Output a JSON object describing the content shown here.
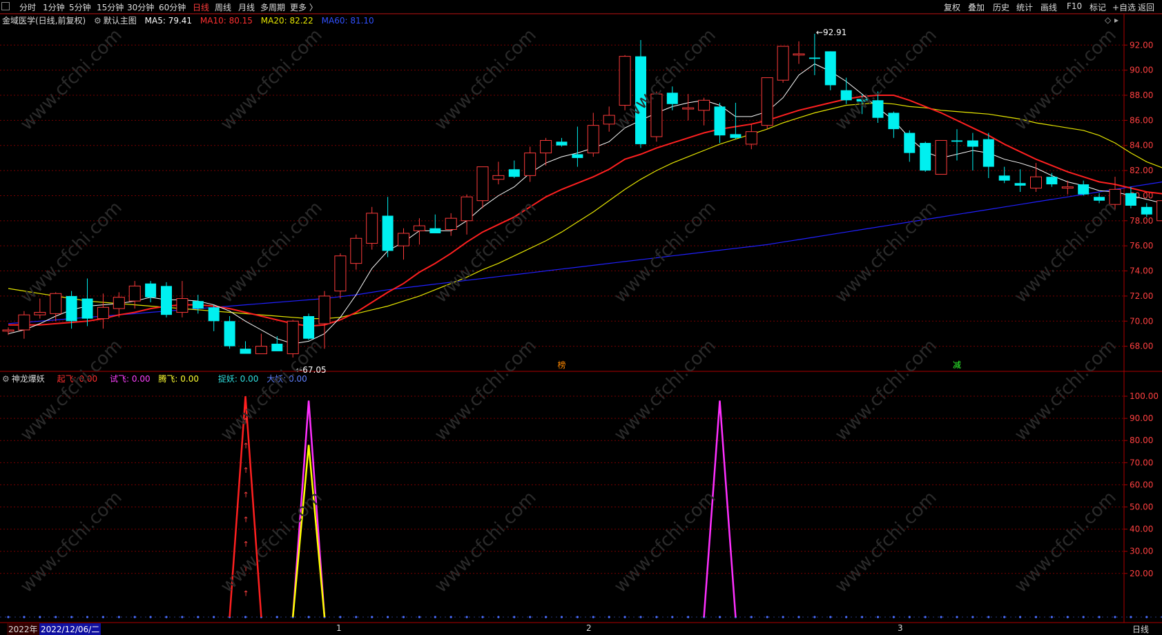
{
  "toolbar": {
    "tabs": [
      "分时",
      "1分钟",
      "5分钟",
      "15分钟",
      "30分钟",
      "60分钟",
      "日线",
      "周线",
      "月线",
      "多周期",
      "更多 〉"
    ],
    "active_tab": "日线",
    "right_buttons": [
      "复权",
      "叠加",
      "历史",
      "统计",
      "画线",
      "F10",
      "标记",
      "+自选",
      "返回"
    ]
  },
  "main_info": {
    "stock": "金域医学(日线,前复权)",
    "template": "默认主图",
    "ma5": "MA5: 79.41",
    "ma10": "MA10: 80.15",
    "ma20": "MA20: 82.22",
    "ma60": "MA60: 81.10"
  },
  "indicator_info": {
    "name": "神龙爆妖",
    "qifei": "起飞: 0.00",
    "shifei": "试飞: 0.00",
    "tengfei": "腾飞: 0.00",
    "zhuoyao": "捉妖: 0.00",
    "dayao": "大妖: 0.00"
  },
  "bottom": {
    "year": "2022年",
    "cursor_date": "2022/12/06/二",
    "month_marks": [
      "1",
      "2",
      "3"
    ],
    "period_button": "日线"
  },
  "colors": {
    "up": "#ff3b3b",
    "down": "#00f0f0",
    "ma5": "#ffffff",
    "ma10": "#ff2020",
    "ma20": "#e6e600",
    "ma60": "#2020ff",
    "qifei": "#ff2020",
    "shifei": "#ff30ff",
    "tengfei": "#ffff00",
    "zhuoyao": "#00e0e0",
    "dayao": "#4a6cff"
  },
  "chart_data": [
    {
      "type": "candlestick",
      "title": "金域医学(日线,前复权)",
      "ylim": [
        66.0,
        93.5
      ],
      "y_ticks": [
        68,
        70,
        72,
        74,
        76,
        78,
        80,
        82,
        84,
        86,
        88,
        90,
        92
      ],
      "y_tick_labels": [
        "68.00",
        "70.00",
        "72.00",
        "74.00",
        "76.00",
        "78.00",
        "80.00",
        "82.00",
        "84.00",
        "86.00",
        "88.00",
        "90.00",
        "92.00"
      ],
      "max_label": "92.91",
      "min_label": "67.05",
      "event_labels": [
        "榜",
        "减"
      ],
      "candles": [
        [
          69.2,
          69.5,
          68.9,
          69.3
        ],
        [
          69.3,
          70.8,
          68.6,
          70.5
        ],
        [
          70.5,
          71.8,
          70.2,
          70.7
        ],
        [
          70.6,
          72.3,
          70.0,
          72.2
        ],
        [
          72.0,
          72.4,
          69.4,
          70.0
        ],
        [
          71.8,
          73.4,
          69.6,
          70.2
        ],
        [
          70.2,
          72.2,
          69.4,
          71.1
        ],
        [
          71.0,
          72.3,
          70.3,
          71.9
        ],
        [
          71.6,
          73.2,
          71.0,
          72.8
        ],
        [
          73.0,
          73.2,
          71.5,
          71.9
        ],
        [
          72.8,
          73.1,
          70.3,
          70.5
        ],
        [
          70.7,
          73.2,
          70.3,
          71.8
        ],
        [
          71.6,
          72.1,
          70.6,
          71.0
        ],
        [
          71.1,
          71.3,
          69.2,
          70.0
        ],
        [
          70.0,
          70.4,
          67.8,
          68.0
        ],
        [
          67.8,
          68.4,
          67.5,
          67.4
        ],
        [
          67.4,
          69.0,
          67.4,
          68.0
        ],
        [
          68.2,
          68.8,
          67.7,
          67.6
        ],
        [
          67.4,
          70.1,
          67.1,
          70.0
        ],
        [
          70.4,
          70.6,
          68.5,
          68.6
        ],
        [
          69.8,
          72.4,
          67.8,
          72.0
        ],
        [
          72.4,
          75.4,
          71.8,
          75.2
        ],
        [
          74.6,
          76.9,
          74.1,
          76.6
        ],
        [
          76.2,
          79.1,
          75.7,
          78.6
        ],
        [
          78.4,
          79.9,
          75.1,
          75.6
        ],
        [
          76.0,
          77.4,
          74.9,
          77.0
        ],
        [
          77.2,
          78.2,
          76.1,
          77.6
        ],
        [
          77.4,
          78.5,
          77.0,
          77.0
        ],
        [
          77.3,
          78.6,
          76.8,
          78.2
        ],
        [
          78.0,
          80.1,
          76.9,
          79.9
        ],
        [
          79.6,
          81.8,
          79.0,
          82.3
        ],
        [
          81.3,
          82.7,
          80.9,
          81.6
        ],
        [
          82.1,
          82.8,
          81.4,
          81.5
        ],
        [
          81.6,
          83.9,
          81.1,
          83.4
        ],
        [
          83.4,
          84.6,
          82.4,
          84.4
        ],
        [
          84.3,
          84.6,
          83.9,
          84.0
        ],
        [
          83.3,
          85.5,
          82.3,
          83.0
        ],
        [
          83.4,
          86.6,
          83.1,
          85.6
        ],
        [
          85.7,
          87.1,
          85.1,
          86.4
        ],
        [
          87.2,
          91.2,
          86.8,
          91.1
        ],
        [
          91.1,
          92.4,
          83.8,
          84.1
        ],
        [
          84.7,
          88.3,
          84.3,
          88.1
        ],
        [
          88.2,
          88.7,
          86.8,
          87.3
        ],
        [
          86.9,
          88.1,
          86.0,
          87.0
        ],
        [
          86.8,
          87.8,
          85.6,
          87.6
        ],
        [
          87.1,
          87.4,
          84.2,
          84.8
        ],
        [
          84.9,
          87.4,
          84.5,
          84.6
        ],
        [
          84.1,
          85.7,
          83.7,
          85.1
        ],
        [
          85.6,
          89.4,
          85.3,
          89.4
        ],
        [
          89.2,
          90.8,
          89.0,
          91.9
        ],
        [
          91.2,
          92.3,
          90.5,
          91.3
        ],
        [
          91.0,
          92.9,
          89.6,
          90.9
        ],
        [
          91.5,
          91.5,
          88.4,
          88.8
        ],
        [
          88.4,
          89.4,
          87.3,
          87.6
        ],
        [
          87.7,
          88.1,
          86.5,
          87.5
        ],
        [
          87.6,
          88.3,
          85.8,
          86.2
        ],
        [
          86.6,
          86.7,
          84.6,
          85.3
        ],
        [
          85.0,
          85.2,
          82.7,
          83.4
        ],
        [
          84.2,
          84.3,
          81.9,
          82.0
        ],
        [
          81.7,
          84.4,
          81.8,
          84.4
        ],
        [
          84.4,
          85.3,
          82.8,
          84.3
        ],
        [
          84.4,
          85.0,
          82.0,
          83.9
        ],
        [
          84.5,
          85.0,
          81.4,
          82.3
        ],
        [
          81.6,
          82.3,
          81.0,
          81.2
        ],
        [
          81.0,
          82.1,
          80.3,
          80.8
        ],
        [
          80.6,
          82.6,
          80.3,
          81.5
        ],
        [
          81.5,
          81.8,
          80.7,
          80.9
        ],
        [
          80.6,
          81.2,
          80.1,
          80.7
        ],
        [
          80.9,
          81.2,
          80.0,
          80.1
        ],
        [
          79.9,
          80.2,
          79.4,
          79.6
        ],
        [
          79.3,
          81.5,
          78.9,
          80.5
        ],
        [
          80.2,
          80.7,
          79.0,
          79.2
        ],
        [
          79.1,
          79.4,
          78.3,
          78.5
        ],
        [
          78.0,
          80.3,
          77.9,
          79.6
        ]
      ],
      "ma5": [
        69.0,
        69.3,
        69.8,
        70.4,
        70.9,
        71.2,
        71.3,
        71.4,
        71.6,
        71.9,
        71.7,
        71.7,
        71.6,
        71.3,
        70.8,
        70.0,
        69.3,
        68.6,
        68.2,
        68.4,
        69.0,
        70.3,
        72.1,
        74.2,
        75.6,
        76.3,
        77.2,
        77.2,
        77.2,
        78.0,
        79.1,
        80.0,
        80.7,
        81.8,
        82.6,
        83.1,
        83.4,
        83.8,
        84.3,
        85.4,
        86.0,
        86.6,
        87.1,
        87.4,
        87.6,
        87.2,
        86.3,
        86.3,
        86.7,
        87.8,
        89.6,
        90.5,
        89.9,
        89.1,
        88.1,
        87.0,
        86.0,
        84.6,
        83.5,
        83.0,
        83.3,
        83.6,
        83.4,
        82.9,
        82.6,
        82.2,
        81.6,
        81.1,
        80.8,
        80.4,
        80.3,
        80.0,
        79.7,
        79.4
      ],
      "ma10": [
        69.7,
        69.7,
        69.7,
        69.8,
        69.9,
        70.0,
        70.2,
        70.5,
        70.7,
        71.0,
        71.2,
        71.3,
        71.3,
        71.2,
        71.0,
        70.7,
        70.4,
        70.1,
        69.8,
        69.6,
        69.7,
        70.1,
        70.7,
        71.5,
        72.3,
        73.0,
        73.9,
        74.6,
        75.4,
        76.3,
        77.1,
        77.7,
        78.3,
        79.1,
        79.9,
        80.5,
        81.0,
        81.5,
        82.1,
        82.9,
        83.3,
        83.8,
        84.2,
        84.6,
        85.0,
        85.3,
        85.5,
        85.7,
        86.0,
        86.4,
        86.8,
        87.1,
        87.4,
        87.7,
        87.9,
        88.0,
        88.0,
        87.6,
        87.1,
        86.6,
        86.0,
        85.4,
        84.8,
        84.1,
        83.5,
        82.9,
        82.4,
        81.9,
        81.5,
        81.1,
        80.9,
        80.6,
        80.3,
        80.15
      ],
      "ma20": [
        72.6,
        72.4,
        72.2,
        72.0,
        71.8,
        71.6,
        71.5,
        71.4,
        71.3,
        71.2,
        71.1,
        71.0,
        70.9,
        70.8,
        70.7,
        70.6,
        70.5,
        70.4,
        70.3,
        70.2,
        70.2,
        70.3,
        70.6,
        70.9,
        71.2,
        71.6,
        72.0,
        72.5,
        73.0,
        73.5,
        74.1,
        74.6,
        75.2,
        75.8,
        76.4,
        77.1,
        77.9,
        78.7,
        79.6,
        80.5,
        81.3,
        82.0,
        82.6,
        83.1,
        83.6,
        84.1,
        84.5,
        84.9,
        85.3,
        85.8,
        86.2,
        86.6,
        86.9,
        87.2,
        87.3,
        87.4,
        87.3,
        87.1,
        87.0,
        86.8,
        86.7,
        86.6,
        86.5,
        86.3,
        86.1,
        85.8,
        85.6,
        85.4,
        85.2,
        84.8,
        84.2,
        83.4,
        82.7,
        82.22
      ],
      "ma60": [
        69.8,
        69.9,
        70.0,
        70.1,
        70.2,
        70.3,
        70.4,
        70.5,
        70.6,
        70.7,
        70.8,
        70.9,
        71.0,
        71.1,
        71.2,
        71.3,
        71.4,
        71.5,
        71.6,
        71.7,
        71.8,
        71.95,
        72.1,
        72.3,
        72.5,
        72.65,
        72.8,
        72.95,
        73.1,
        73.25,
        73.4,
        73.55,
        73.7,
        73.85,
        74.0,
        74.15,
        74.3,
        74.45,
        74.6,
        74.75,
        74.9,
        75.05,
        75.2,
        75.35,
        75.5,
        75.65,
        75.8,
        75.95,
        76.1,
        76.3,
        76.5,
        76.7,
        76.9,
        77.1,
        77.3,
        77.5,
        77.7,
        77.9,
        78.1,
        78.3,
        78.5,
        78.7,
        78.9,
        79.1,
        79.3,
        79.5,
        79.7,
        79.9,
        80.1,
        80.3,
        80.5,
        80.7,
        80.9,
        81.1
      ]
    },
    {
      "type": "line",
      "title": "神龙爆妖",
      "ylim": [
        0,
        105
      ],
      "y_ticks": [
        20,
        30,
        40,
        50,
        60,
        70,
        80,
        90,
        100
      ],
      "y_tick_labels": [
        "20.00",
        "30.00",
        "40.00",
        "50.00",
        "60.00",
        "70.00",
        "80.00",
        "90.00",
        "100.00"
      ],
      "series": [
        {
          "name": "起飞",
          "spikes": [
            {
              "x": 15,
              "peak": 100
            }
          ]
        },
        {
          "name": "试飞",
          "spikes": [
            {
              "x": 19,
              "peak": 98
            },
            {
              "x": 45,
              "peak": 98
            }
          ]
        },
        {
          "name": "腾飞",
          "spikes": [
            {
              "x": 19,
              "peak": 78
            }
          ]
        },
        {
          "name": "捉妖",
          "spikes": []
        },
        {
          "name": "大妖",
          "spikes": []
        }
      ]
    }
  ]
}
